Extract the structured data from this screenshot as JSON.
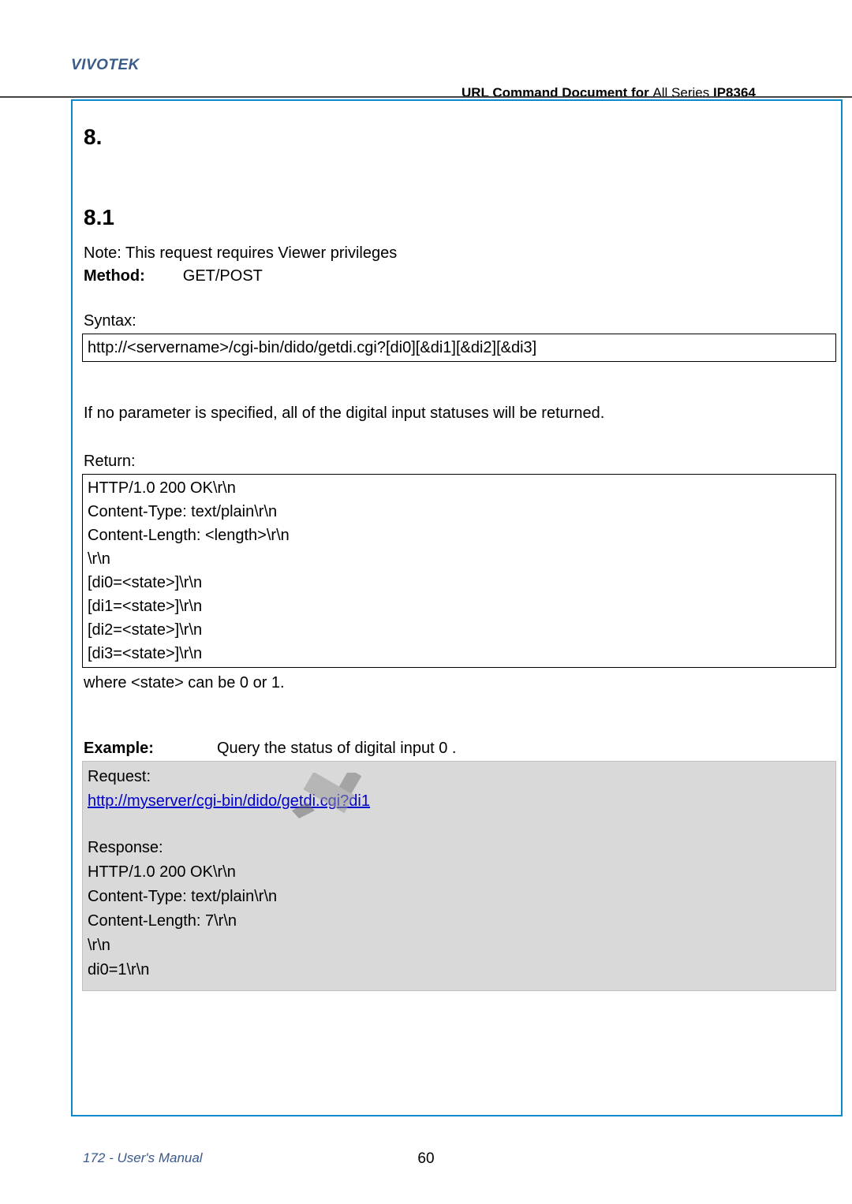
{
  "brand": "VIVOTEK",
  "header": {
    "bold": "URL Command Document for ",
    "series": "All Series",
    "model": "IP8364"
  },
  "section_marker_1": "8.",
  "section_marker_2": "8.1",
  "note_line": "Note: This request requires Viewer privileges",
  "method": {
    "label": "Method:",
    "value": "GET/POST"
  },
  "syntax_label": "Syntax:",
  "syntax_box": "http://<servername>/cgi-bin/dido/getdi.cgi?[di0][&di1][&di2][&di3]",
  "if_no_param": "If no parameter is specified, all of the digital input statuses will be returned.",
  "return_label": "Return:",
  "return_lines": [
    "HTTP/1.0 200 OK\\r\\n",
    "Content-Type: text/plain\\r\\n",
    "Content-Length: <length>\\r\\n",
    "\\r\\n",
    "[di0=<state>]\\r\\n",
    "[di1=<state>]\\r\\n",
    "[di2=<state>]\\r\\n",
    "[di3=<state>]\\r\\n"
  ],
  "where_line": "where <state> can be 0 or 1.",
  "example": {
    "label": "Example:",
    "text": "Query the status of digital input 0 ."
  },
  "gray": {
    "request_label": "Request:",
    "request_url_display": "http://myserver/cgi-bin/dido/getdi.cgi?di1",
    "request_url_href": "http://myserver/cgi-bin/dido/getdi.cgi?di1",
    "response_label": "Response:",
    "response_lines": [
      "HTTP/1.0 200 OK\\r\\n",
      "Content-Type: text/plain\\r\\n",
      "Content-Length: 7\\r\\n",
      "\\r\\n",
      "di0=1\\r\\n"
    ]
  },
  "footer": {
    "left": "172 - User's Manual",
    "center": "60"
  }
}
